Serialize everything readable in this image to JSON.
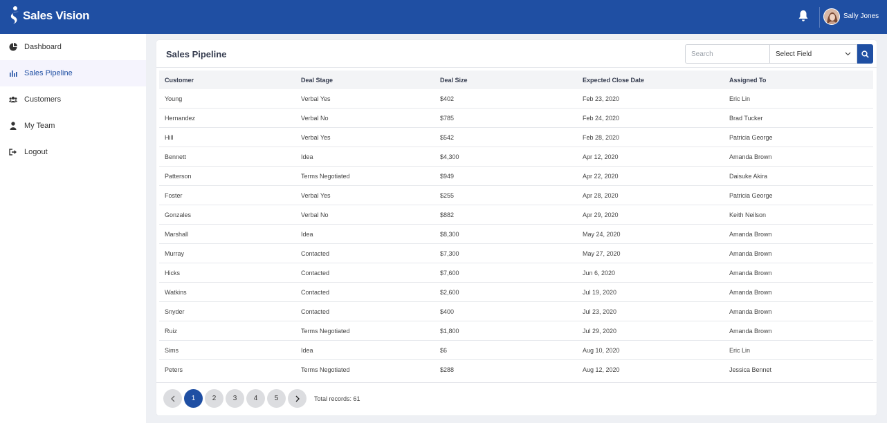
{
  "app": {
    "name": "Sales Vision"
  },
  "user": {
    "name": "Sally Jones"
  },
  "sidebar": {
    "items": [
      {
        "label": "Dashboard",
        "icon": "pie-chart-icon"
      },
      {
        "label": "Sales Pipeline",
        "icon": "bar-chart-icon",
        "active": true
      },
      {
        "label": "Customers",
        "icon": "users-icon"
      },
      {
        "label": "My Team",
        "icon": "user-icon"
      },
      {
        "label": "Logout",
        "icon": "logout-icon"
      }
    ]
  },
  "page": {
    "title": "Sales Pipeline",
    "search": {
      "placeholder": "Search",
      "value": ""
    },
    "select_field": {
      "value": "Select Field"
    }
  },
  "table": {
    "headers": [
      "Customer",
      "Deal Stage",
      "Deal Size",
      "Expected Close Date",
      "Assigned To"
    ],
    "rows": [
      [
        "Young",
        "Verbal Yes",
        "$402",
        "Feb 23, 2020",
        "Eric Lin"
      ],
      [
        "Hernandez",
        "Verbal No",
        "$785",
        "Feb 24, 2020",
        "Brad Tucker"
      ],
      [
        "Hill",
        "Verbal Yes",
        "$542",
        "Feb 28, 2020",
        "Patricia George"
      ],
      [
        "Bennett",
        "Idea",
        "$4,300",
        "Apr 12, 2020",
        "Amanda Brown"
      ],
      [
        "Patterson",
        "Terms Negotiated",
        "$949",
        "Apr 22, 2020",
        "Daisuke Akira"
      ],
      [
        "Foster",
        "Verbal Yes",
        "$255",
        "Apr 28, 2020",
        "Patricia George"
      ],
      [
        "Gonzales",
        "Verbal No",
        "$882",
        "Apr 29, 2020",
        "Keith Neilson"
      ],
      [
        "Marshall",
        "Idea",
        "$8,300",
        "May 24, 2020",
        "Amanda Brown"
      ],
      [
        "Murray",
        "Contacted",
        "$7,300",
        "May 27, 2020",
        "Amanda Brown"
      ],
      [
        "Hicks",
        "Contacted",
        "$7,600",
        "Jun 6, 2020",
        "Amanda Brown"
      ],
      [
        "Watkins",
        "Contacted",
        "$2,600",
        "Jul 19, 2020",
        "Amanda Brown"
      ],
      [
        "Snyder",
        "Contacted",
        "$400",
        "Jul 23, 2020",
        "Amanda Brown"
      ],
      [
        "Ruiz",
        "Terms Negotiated",
        "$1,800",
        "Jul 29, 2020",
        "Amanda Brown"
      ],
      [
        "Sims",
        "Idea",
        "$6",
        "Aug 10, 2020",
        "Eric Lin"
      ],
      [
        "Peters",
        "Terms Negotiated",
        "$288",
        "Aug 12, 2020",
        "Jessica Bennet"
      ]
    ]
  },
  "pagination": {
    "pages": [
      "1",
      "2",
      "3",
      "4",
      "5"
    ],
    "current": "1",
    "total_records": "Total records: 61"
  },
  "colors": {
    "brand": "#1f4fa3",
    "sidebar_active_bg": "#f5f4fd",
    "page_bg": "#eef0f4"
  }
}
